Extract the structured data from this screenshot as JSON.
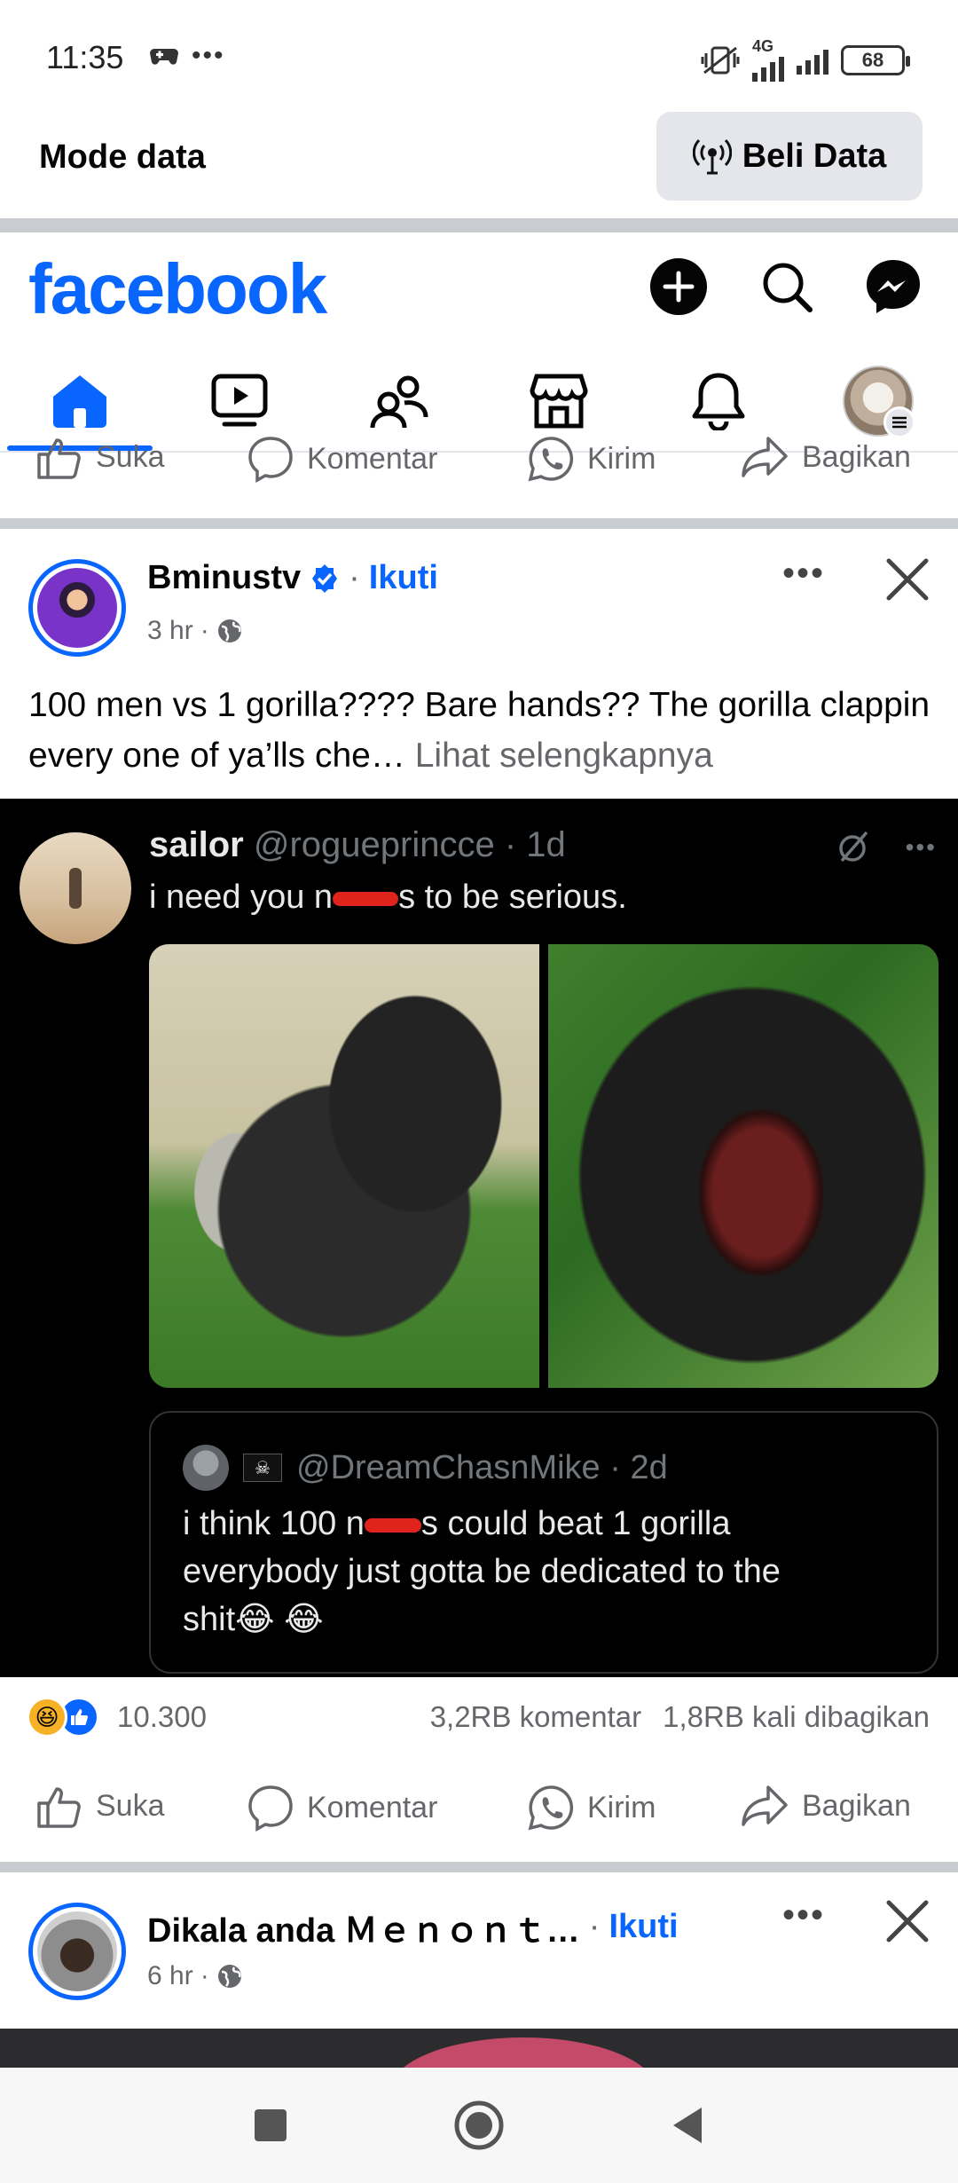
{
  "status_bar": {
    "time": "11:35",
    "battery": "68",
    "network": "4G"
  },
  "data_bar": {
    "title": "Mode data",
    "buy_label": "Beli Data"
  },
  "header": {
    "logo": "facebook"
  },
  "top_actions": {
    "like": "Suka",
    "comment": "Komentar",
    "send": "Kirim",
    "share": "Bagikan"
  },
  "post1": {
    "author": "Bminustv",
    "follow": "Ikuti",
    "time": "3 hr",
    "caption": "100 men vs 1 gorilla???? Bare hands?? The gorilla clappin every one of ya’lls che…",
    "see_more": "Lihat selengkapnya",
    "tweet": {
      "name": "sailor",
      "handle": "@rogueprincce · 1d",
      "text_before": "i need you n",
      "text_after": "s to be serious.",
      "quote": {
        "handle": "@DreamChasnMike · 2d",
        "line1_before": "i think 100 n",
        "line1_after": "s could beat 1 gorilla",
        "line2": "everybody just gotta be dedicated to the",
        "line3": "shit😂 😂"
      }
    },
    "reaction_count": "10.300",
    "comments": "3,2RB komentar",
    "shares": "1,8RB kali dibagikan",
    "actions": {
      "like": "Suka",
      "comment": "Komentar",
      "send": "Kirim",
      "share": "Bagikan"
    }
  },
  "post2": {
    "author": "Dikala anda Ｍｅｎｏｎｔ…",
    "follow": "Ikuti",
    "time": "6 hr"
  },
  "colors": {
    "brand": "#0866ff",
    "muted": "#65676b",
    "divider": "#c9ccd1"
  }
}
